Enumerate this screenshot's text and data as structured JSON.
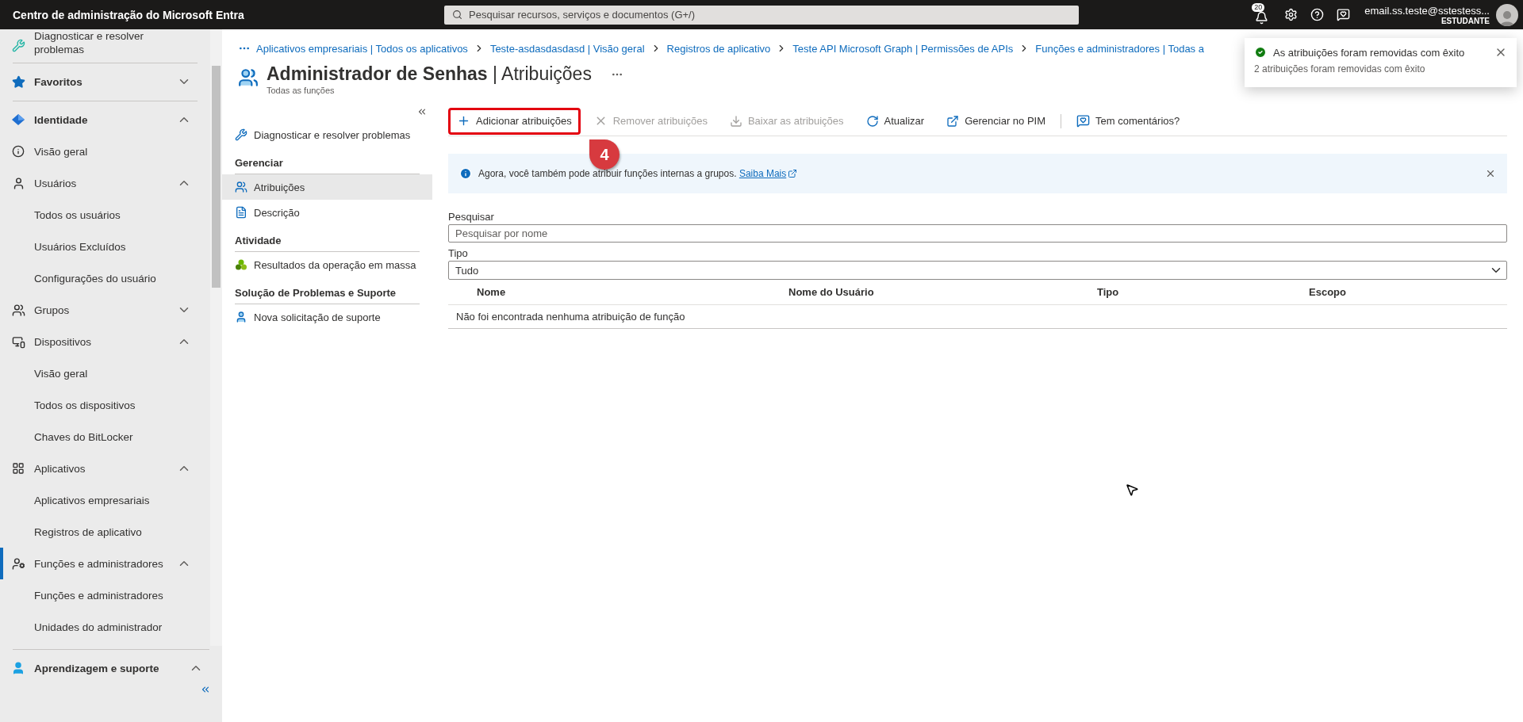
{
  "topbar": {
    "title": "Centro de administração do Microsoft Entra",
    "search_placeholder": "Pesquisar recursos, serviços e documentos (G+/)",
    "notification_count": "20",
    "account_email": "email.ss.teste@sstestess...",
    "account_role": "ESTUDANTE"
  },
  "nav": {
    "items": [
      {
        "kind": "item",
        "label": "Diagnosticar e resolver problemas",
        "selected": false
      },
      {
        "kind": "section",
        "label": "Favoritos",
        "expanded": false,
        "selected": false
      },
      {
        "kind": "section",
        "label": "Identidade",
        "expanded": true,
        "selected": false
      },
      {
        "kind": "item",
        "label": "Visão geral",
        "selected": false
      },
      {
        "kind": "item",
        "label": "Usuários",
        "expanded": true,
        "selected": false
      },
      {
        "kind": "subitem",
        "label": "Todos os usuários",
        "selected": false
      },
      {
        "kind": "subitem",
        "label": "Usuários Excluídos",
        "selected": false
      },
      {
        "kind": "subitem",
        "label": "Configurações do usuário",
        "selected": false
      },
      {
        "kind": "item",
        "label": "Grupos",
        "expanded": false,
        "selected": false
      },
      {
        "kind": "item",
        "label": "Dispositivos",
        "expanded": true,
        "selected": false
      },
      {
        "kind": "subitem",
        "label": "Visão geral",
        "selected": false
      },
      {
        "kind": "subitem",
        "label": "Todos os dispositivos",
        "selected": false
      },
      {
        "kind": "subitem",
        "label": "Chaves do BitLocker",
        "selected": false
      },
      {
        "kind": "item",
        "label": "Aplicativos",
        "expanded": true,
        "selected": false
      },
      {
        "kind": "subitem",
        "label": "Aplicativos empresariais",
        "selected": false
      },
      {
        "kind": "subitem",
        "label": "Registros de aplicativo",
        "selected": false
      },
      {
        "kind": "item",
        "label": "Funções e administradores",
        "expanded": true,
        "selected": true
      },
      {
        "kind": "subitem",
        "label": "Funções e administradores",
        "selected": false
      },
      {
        "kind": "subitem",
        "label": "Unidades do administrador",
        "selected": false
      }
    ],
    "footer": {
      "label": "Aprendizagem e suporte",
      "expanded": true
    }
  },
  "breadcrumb": [
    "Aplicativos empresariais | Todos os aplicativos",
    "Teste-asdasdasdasd | Visão geral",
    "Registros de aplicativo",
    "Teste API Microsoft Graph | Permissões de APIs",
    "Funções e administradores | Todas a"
  ],
  "page": {
    "title": "**Administrador de Senhas** | Atribuições",
    "subtitle": "Todas as funções"
  },
  "resource_menu": [
    {
      "kind": "link",
      "label": "Diagnosticar e resolver problemas",
      "selected": false
    },
    {
      "kind": "group",
      "label": "Gerenciar"
    },
    {
      "kind": "link",
      "label": "Atribuições",
      "selected": true
    },
    {
      "kind": "link",
      "label": "Descrição",
      "selected": false
    },
    {
      "kind": "group",
      "label": "Atividade"
    },
    {
      "kind": "link",
      "label": "Resultados da operação em massa",
      "selected": false
    },
    {
      "kind": "group",
      "label": "Solução de Problemas e Suporte"
    },
    {
      "kind": "link",
      "label": "Nova solicitação de suporte",
      "selected": false
    }
  ],
  "toolbar": [
    {
      "label": "Adicionar atribuições",
      "disabled": false,
      "highlighted": true
    },
    {
      "label": "Remover atribuições",
      "disabled": true,
      "highlighted": false
    },
    {
      "label": "Baixar as atribuições",
      "disabled": true,
      "highlighted": false
    },
    {
      "label": "Atualizar",
      "disabled": false,
      "highlighted": false
    },
    {
      "label": "Gerenciar no PIM",
      "disabled": false,
      "highlighted": false
    },
    {
      "label": "Tem comentários?",
      "disabled": false,
      "highlighted": false
    }
  ],
  "banner": {
    "text": "Agora, você também pode atribuir funções internas a grupos.",
    "link": "Saiba Mais"
  },
  "filters": {
    "search_label": "Pesquisar",
    "search_placeholder": "Pesquisar por nome",
    "type_label": "Tipo",
    "type_value": "Tudo"
  },
  "table": {
    "columns": [
      "Nome",
      "Nome do Usuário",
      "Tipo",
      "Escopo"
    ],
    "empty_message": "Não foi encontrada nenhuma atribuição de função"
  },
  "toast": {
    "title": "As atribuições foram removidas com êxito",
    "message": "2 atribuições foram removidas com êxito"
  },
  "annotation": {
    "label": "4"
  }
}
